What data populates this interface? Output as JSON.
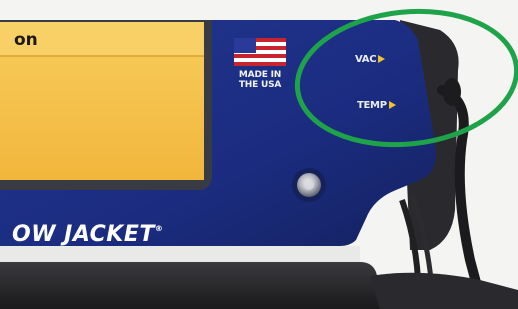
{
  "device": {
    "screen_text": "on",
    "made_in_label": "MADE IN THE USA",
    "vac_label": "VAC",
    "temp_label": "TEMP",
    "brand_text": "OW JACKET",
    "trademark": "®"
  },
  "colors": {
    "panel_blue": "#1b2e86",
    "screen_amber": "#f6c24a",
    "annotation_green": "#1ea34a",
    "arrow_yellow": "#f2c12e"
  },
  "icons": {
    "flag": "us-flag-icon",
    "arrow": "arrow-right-icon",
    "screw": "screw-icon"
  }
}
